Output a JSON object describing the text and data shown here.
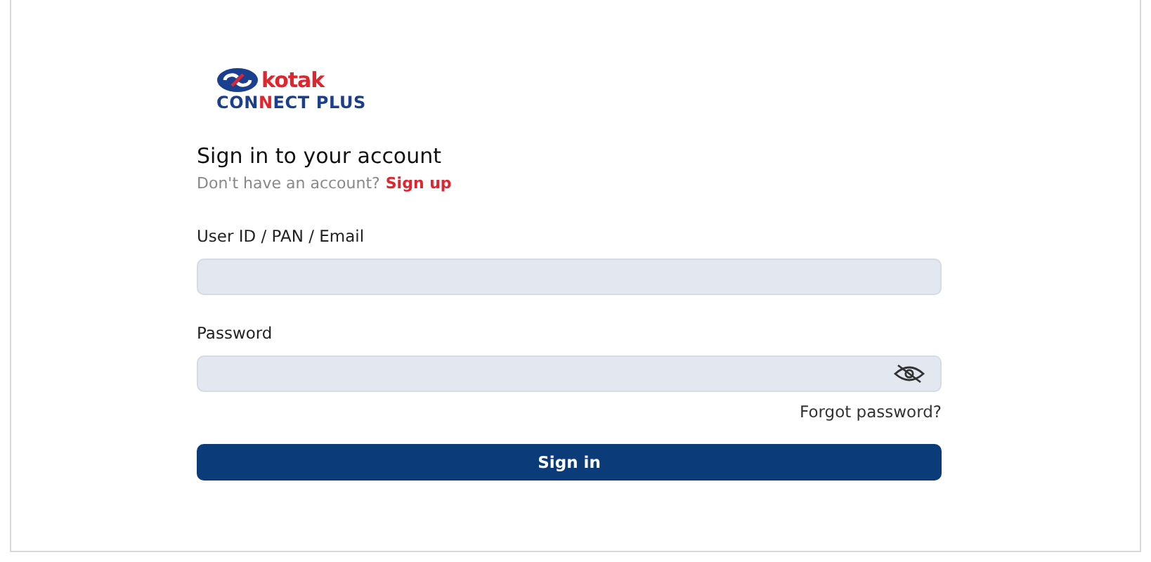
{
  "logo": {
    "brand": "kotak",
    "product": [
      {
        "text": "CON",
        "accent": false
      },
      {
        "text": "N",
        "accent": true
      },
      {
        "text": "ECT PLUS",
        "accent": false
      }
    ]
  },
  "heading": "Sign in to your account",
  "signup": {
    "prompt": "Don't have an account?",
    "link": "Sign up"
  },
  "fields": [
    {
      "label": "User ID / PAN / Email",
      "kind": "text"
    },
    {
      "label": "Password",
      "kind": "password"
    }
  ],
  "forgot": "Forgot password?",
  "button": "Sign in"
}
